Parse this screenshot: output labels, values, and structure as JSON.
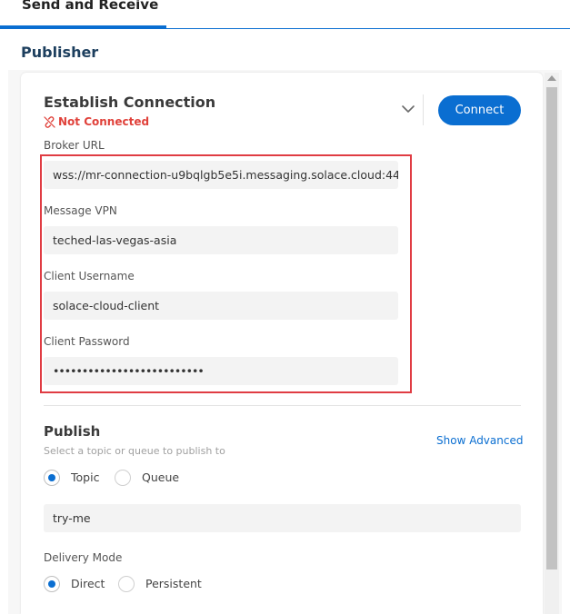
{
  "tab": {
    "label": "Send and Receive"
  },
  "section": {
    "title": "Publisher"
  },
  "connection": {
    "heading": "Establish Connection",
    "status": "Not Connected",
    "connect_label": "Connect",
    "broker_url_label": "Broker URL",
    "broker_url_value": "wss://mr-connection-u9bqlgb5e5i.messaging.solace.cloud:44",
    "vpn_label": "Message VPN",
    "vpn_value": "teched-las-vegas-asia",
    "username_label": "Client Username",
    "username_value": "solace-cloud-client",
    "password_label": "Client Password",
    "password_value": "••••••••••••••••••••••••••"
  },
  "publish": {
    "heading": "Publish",
    "subtitle": "Select a topic or queue to publish to",
    "show_advanced": "Show Advanced",
    "dest_topic": "Topic",
    "dest_queue": "Queue",
    "topic_value": "try-me",
    "delivery_label": "Delivery Mode",
    "mode_direct": "Direct",
    "mode_persistent": "Persistent"
  },
  "colors": {
    "accent": "#0a6ed1",
    "error": "#e0413a",
    "highlight": "#e03c43"
  },
  "icons": {
    "status": "unlink-icon",
    "expand": "chevron-down-icon"
  }
}
